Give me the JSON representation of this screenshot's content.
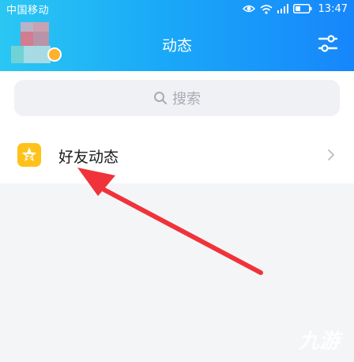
{
  "status_bar": {
    "carrier": "中国移动",
    "time": "13:47"
  },
  "header": {
    "title": "动态"
  },
  "search": {
    "placeholder": "搜索"
  },
  "list": {
    "items": [
      {
        "label": "好友动态"
      }
    ]
  },
  "watermark": {
    "text": "九游"
  },
  "colors": {
    "header_start": "#2bc7f3",
    "header_end": "#1786fb",
    "icon_bg": "#ffc21a",
    "arrow": "#f0333a"
  },
  "icons": [
    "eye-icon",
    "wifi-icon",
    "signal-icon",
    "battery-icon",
    "settings-sliders-icon",
    "search-icon",
    "star-icon",
    "chevron-right-icon"
  ]
}
